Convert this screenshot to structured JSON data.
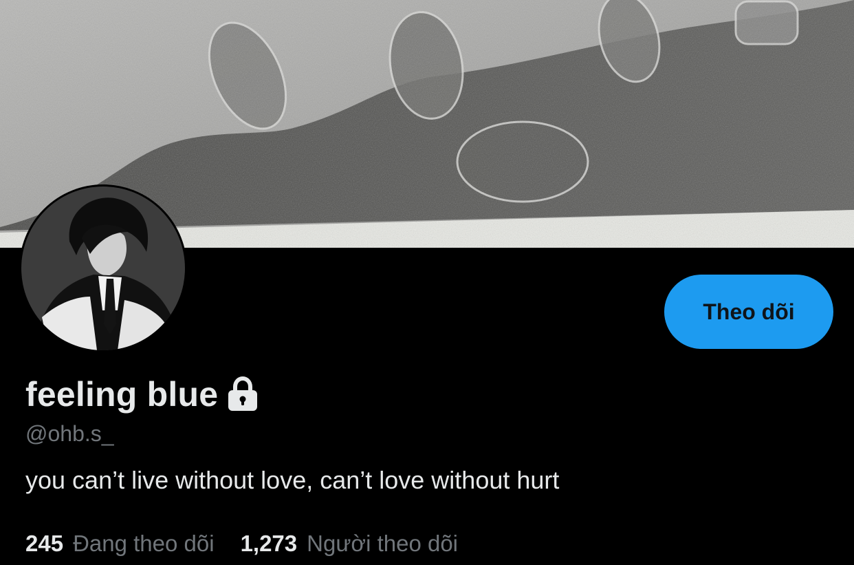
{
  "profile": {
    "display_name": "feeling blue",
    "handle": "@ohb.s_",
    "bio": "you can’t live without love, can’t love without hurt",
    "protected_icon": "lock-icon",
    "banner_image": "footprints-in-sand-photo",
    "avatar_image": "person-in-track-jacket-photo"
  },
  "actions": {
    "follow_label": "Theo dõi"
  },
  "stats": {
    "following_count": "245",
    "following_label": "Đang theo dõi",
    "followers_count": "1,273",
    "followers_label": "Người theo dõi"
  },
  "colors": {
    "background": "#000000",
    "accent": "#1d9bf0",
    "primary_text": "#e7e9ea",
    "secondary_text": "#71767b"
  }
}
